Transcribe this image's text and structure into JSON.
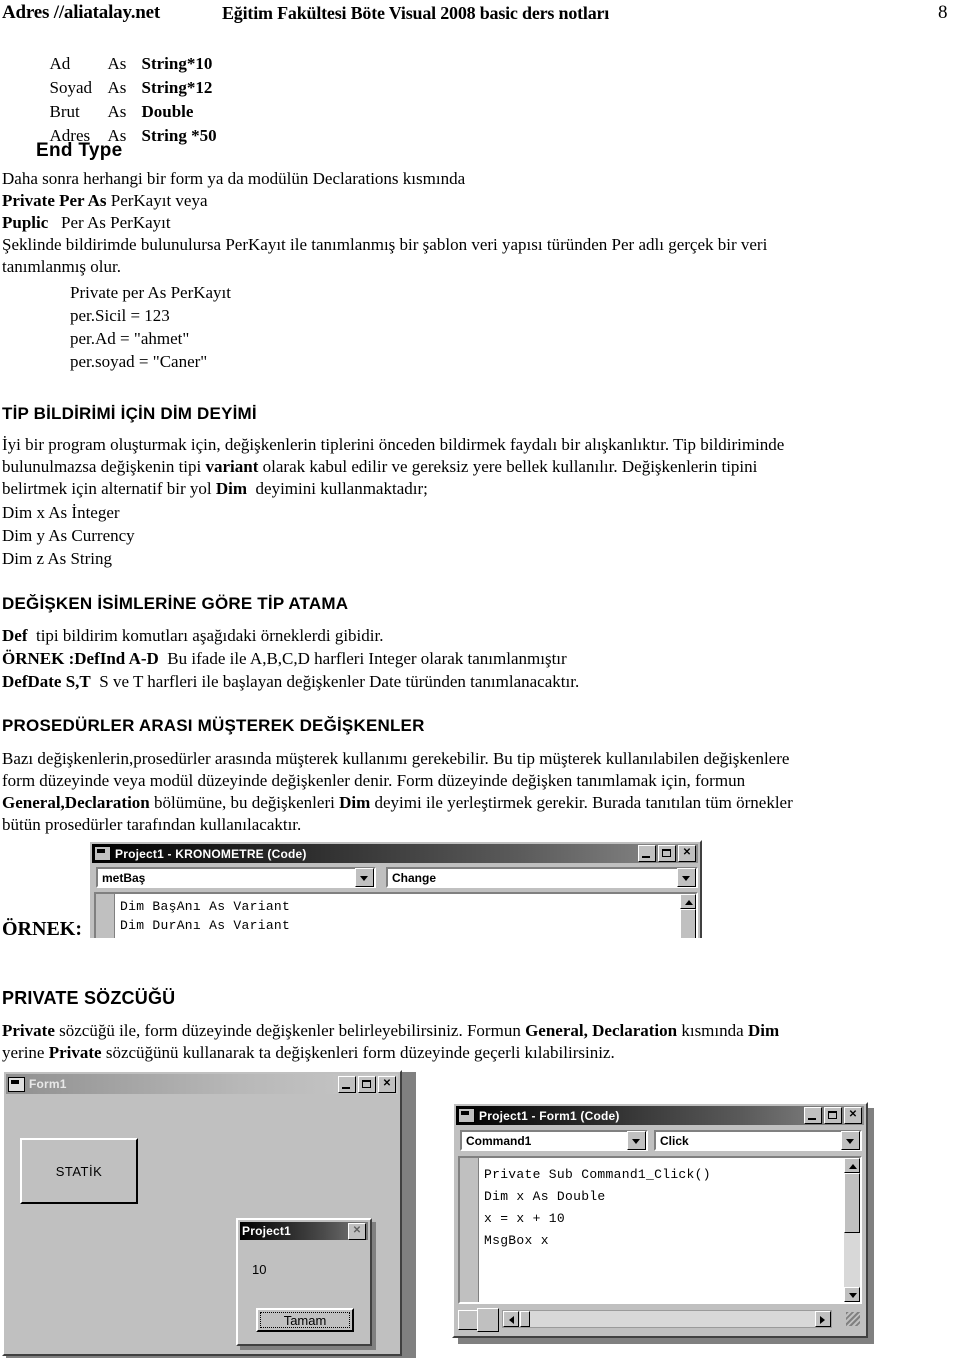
{
  "header": {
    "address": "Adres //aliatalay.net",
    "title": "Eğitim Fakültesi Böte Visual 2008 basic ders notları",
    "page_number": "8"
  },
  "type_block": {
    "lines": [
      {
        "name": "Ad",
        "as": "As",
        "type": "String*10"
      },
      {
        "name": "Soyad",
        "as": "As",
        "type": "String*12"
      },
      {
        "name": "Brut",
        "as": "As",
        "type": "Double"
      },
      {
        "name": "Adres",
        "as": "As",
        "type": "String *50"
      }
    ],
    "end_type": "End Type"
  },
  "body": {
    "p1": "Daha sonra herhangi bir form ya da modülün Declarations kısmında",
    "p2_bold": "Private Per As",
    "p2_rest": " PerKayıt veya",
    "p3_bold": "Puplic",
    "p3_mid": "   Per As",
    "p3_rest": " PerKayıt",
    "p4": "Şeklinde bildirimde bulunulursa PerKayıt ile tanımlanmış bir şablon veri yapısı türünden Per adlı gerçek bir veri",
    "p5": "tanımlanmış olur.",
    "code1": [
      "Private per As PerKayıt",
      "per.Sicil = 123",
      "per.Ad = \"ahmet\"",
      "per.soyad = \"Caner\""
    ],
    "sec1": "TİP BİLDİRİMİ İÇİN DİM DEYİMİ",
    "s1_l1a": "İyi bir program oluşturmak için, değişkenlerin tiplerini önceden bildirmek faydalı bir alışkanlıktır. Tip bildiriminde",
    "s1_l2a": "bulunulmazsa değişkenin tipi ",
    "s1_l2b": "variant",
    "s1_l2c": " olarak kabul edilir ve gereksiz yere bellek kullanılır. Değişkenlerin tipini",
    "s1_l3a": "belirtmek için alternatif bir yol ",
    "s1_l3b": "Dim",
    "s1_l3c": "  deyimini kullanmaktadır;",
    "dim_lines": [
      "Dim x As İnteger",
      "Dim y As Currency",
      "Dim z As String"
    ],
    "sec2": "DEĞİŞKEN İSİMLERİNE GÖRE TİP ATAMA",
    "s2_l1a": "Def",
    "s2_l1b": "  tipi bildirim komutları aşağıdaki örneklerdi gibidir.",
    "s2_l2a": "ÖRNEK :DefInd  A-D",
    "s2_l2b": "  Bu ifade ile A,B,C,D harfleri Integer olarak tanımlanmıştır",
    "s2_l3a": "DefDate  S,T",
    "s2_l3b": "  S ve T harfleri ile başlayan değişkenler Date türünden tanımlanacaktır.",
    "sec3": "PROSEDÜRLER ARASI MÜŞTEREK DEĞİŞKENLER",
    "s3_l1": "Bazı değişkenlerin,prosedürler arasında müşterek kullanımı gerekebilir. Bu tip müşterek kullanılabilen değişkenlere",
    "s3_l2": "form düzeyinde veya modül düzeyinde değişkenler denir. Form düzeyinde değişken tanımlamak için, formun",
    "s3_l3a": "General,Declaration",
    "s3_l3b": " bölümüne, bu değişkenleri ",
    "s3_l3c": "Dim",
    "s3_l3d": " deyimi ile yerleştirmek gerekir. Burada tanıtılan tüm örnekler",
    "s3_l4": "bütün prosedürler tarafından kullanılacaktır.",
    "ornek_label": "ÖRNEK:",
    "sec4": "PRIVATE  SÖZCÜĞÜ",
    "s4_l1a": "Private",
    "s4_l1b": " sözcüğü ile, form düzeyinde değişkenler belirleyebilirsiniz. Formun ",
    "s4_l1c": "General, Declaration",
    "s4_l1d": " kısmında ",
    "s4_l1e": "Dim",
    "s4_l2a": "yerine ",
    "s4_l2b": "Private",
    "s4_l2c": " sözcüğünü kullanarak ta değişkenleri form düzeyinde geçerli kılabilirsiniz."
  },
  "screenshot_kronometre": {
    "title": "Project1 - KRONOMETRE (Code)",
    "icon": "vb-form-icon",
    "minimize": "_",
    "maximize": "□",
    "close": "✕",
    "object_combo": "metBaş",
    "event_combo": "Change",
    "code": "Dim BaşAnı As Variant\nDim DurAnı As Variant\nDim GeçenSüre As Variant"
  },
  "screenshot_form1": {
    "title": "Form1",
    "icon": "vb-form-icon",
    "minimize": "_",
    "maximize": "□",
    "close": "✕",
    "button_label": "STATİK"
  },
  "screenshot_msgbox": {
    "title": "Project1",
    "close": "✕",
    "message": "10",
    "ok_label": "Tamam"
  },
  "screenshot_form1_code": {
    "title": "Project1 - Form1 (Code)",
    "icon": "vb-form-icon",
    "minimize": "_",
    "maximize": "□",
    "close": "✕",
    "object_combo": "Command1",
    "event_combo": "Click",
    "code": "Private Sub Command1_Click()\nDim x As Double\nx = x + 10\nMsgBox x"
  },
  "colors": {
    "window_face": "#c0c0c0",
    "titlebar_start": "#000000",
    "titlebar_end": "#8d8d8d",
    "code_bg": "#ffffff",
    "text": "#000000"
  }
}
